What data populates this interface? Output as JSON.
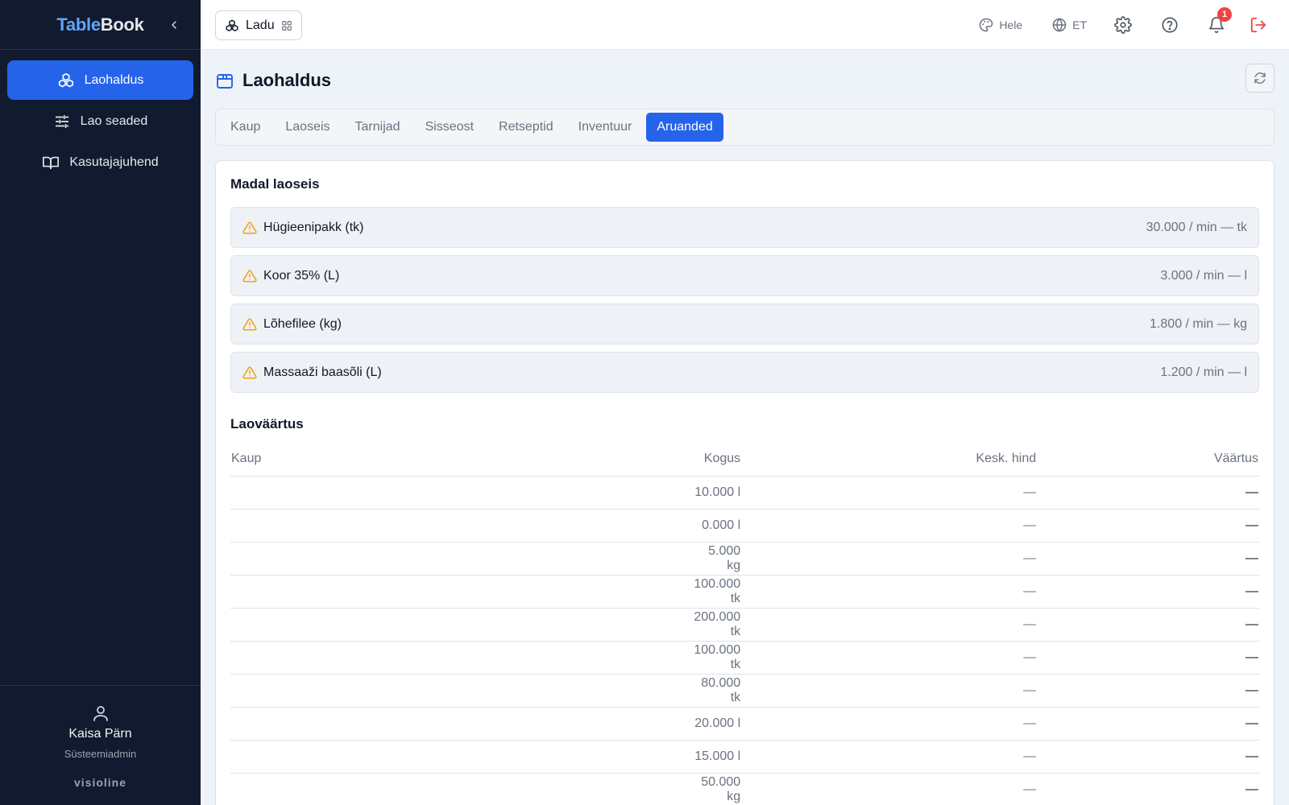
{
  "sidebar": {
    "brand_part1": "Table",
    "brand_part2": "Book",
    "items": [
      {
        "label": "Laohaldus",
        "icon": "boxes-icon",
        "active": true
      },
      {
        "label": "Lao seaded",
        "icon": "sliders-icon",
        "active": false
      },
      {
        "label": "Kasutajajuhend",
        "icon": "book-icon",
        "active": false
      }
    ],
    "user": {
      "name": "Kaisa Pärn",
      "role": "Süsteemiadmin"
    },
    "footer_logo": "visioline"
  },
  "topbar": {
    "module_label": "Ladu",
    "theme_label": "Hele",
    "language_label": "ET",
    "notification_count": "1"
  },
  "page": {
    "title": "Laohaldus",
    "tabs": [
      {
        "label": "Kaup",
        "active": false
      },
      {
        "label": "Laoseis",
        "active": false
      },
      {
        "label": "Tarnijad",
        "active": false
      },
      {
        "label": "Sisseost",
        "active": false
      },
      {
        "label": "Retseptid",
        "active": false
      },
      {
        "label": "Inventuur",
        "active": false
      },
      {
        "label": "Aruanded",
        "active": true
      }
    ]
  },
  "low_stock": {
    "title": "Madal laoseis",
    "items": [
      {
        "name": "Hügieenipakk (tk)",
        "detail": "30.000 / min — tk"
      },
      {
        "name": "Koor 35% (L)",
        "detail": "3.000 / min — l"
      },
      {
        "name": "Lõhefilee (kg)",
        "detail": "1.800 / min — kg"
      },
      {
        "name": "Massaaži baasõli (L)",
        "detail": "1.200 / min — l"
      }
    ]
  },
  "stock_value": {
    "title": "Laoväärtus",
    "columns": [
      "Kaup",
      "Kogus",
      "Kesk. hind",
      "Väärtus"
    ],
    "rows": [
      {
        "item": "",
        "quantity": "10.000 l",
        "avg_price": "—",
        "value": "—"
      },
      {
        "item": "",
        "quantity": "0.000 l",
        "avg_price": "—",
        "value": "—"
      },
      {
        "item": "",
        "quantity": "5.000 kg",
        "avg_price": "—",
        "value": "—"
      },
      {
        "item": "",
        "quantity": "100.000 tk",
        "avg_price": "—",
        "value": "—"
      },
      {
        "item": "",
        "quantity": "200.000 tk",
        "avg_price": "—",
        "value": "—"
      },
      {
        "item": "",
        "quantity": "100.000 tk",
        "avg_price": "—",
        "value": "—"
      },
      {
        "item": "",
        "quantity": "80.000 tk",
        "avg_price": "—",
        "value": "—"
      },
      {
        "item": "",
        "quantity": "20.000 l",
        "avg_price": "—",
        "value": "—"
      },
      {
        "item": "",
        "quantity": "15.000 l",
        "avg_price": "—",
        "value": "—"
      },
      {
        "item": "",
        "quantity": "50.000 kg",
        "avg_price": "—",
        "value": "—"
      }
    ]
  },
  "colors": {
    "sidebar_bg": "#111a2e",
    "accent": "#2563eb",
    "warning": "#f59e0b",
    "danger": "#ef4444"
  }
}
